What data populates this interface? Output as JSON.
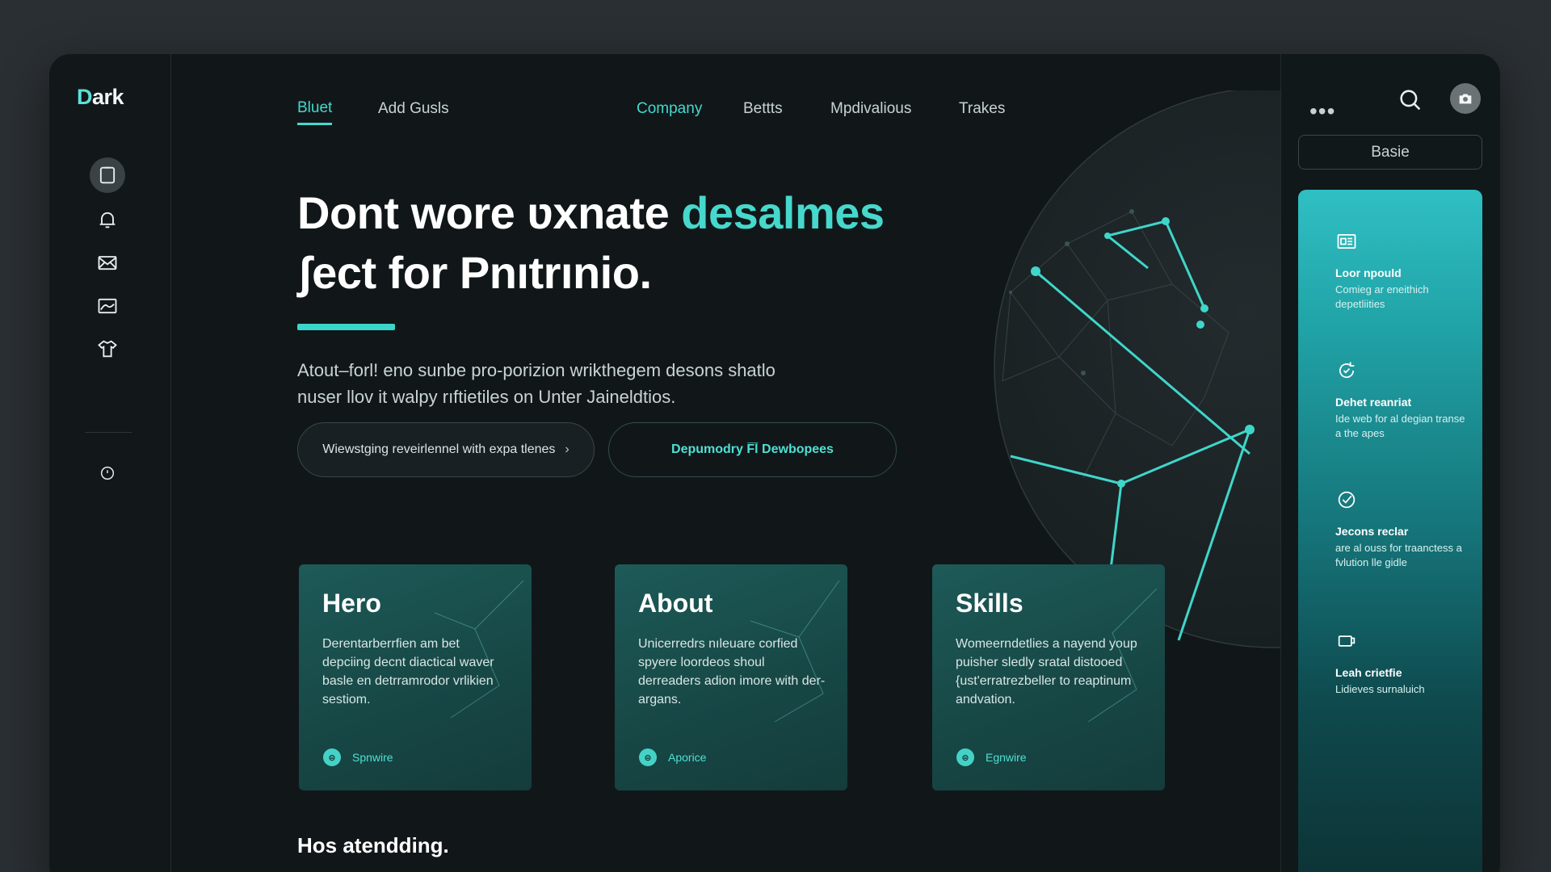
{
  "app": {
    "logo": "Dark",
    "logo_first": "D",
    "logo_rest": "ark"
  },
  "nav": {
    "items": [
      {
        "label": "Bluet",
        "state": "active"
      },
      {
        "label": "Add Gusls",
        "state": "normal"
      },
      {
        "label": "Company",
        "state": "accent"
      },
      {
        "label": "Bettts",
        "state": "normal"
      },
      {
        "label": "Mpdivalious",
        "state": "normal"
      },
      {
        "label": "Trakes",
        "state": "normal"
      }
    ]
  },
  "sidebar": {
    "icons": [
      "clipboard-icon",
      "bell-icon",
      "mail-icon",
      "image-icon",
      "shirt-icon",
      "power-icon"
    ]
  },
  "hero": {
    "title_part1": "Dont wore ʋxnate ",
    "title_highlight": "desalmes",
    "title_line2": "ʃect for Pnıtrınio.",
    "description_line1": "Atout–forl! eno sunbe pro-porizion wrikthegem desons shatlo",
    "description_line2": "nuser llov it walpy rıftietiles on Unter Jaineldtios.",
    "button_primary": "Wiewstging reveirlennel with expa tlenes",
    "button_secondary": "Depumodry F̅̅l Dewbopees"
  },
  "cards": [
    {
      "title": "Hero",
      "body": "Derentarberrfien am bet depciing decnt diactical waver basle en detrramrodor vrlikien sestiom.",
      "link": "Spnwire"
    },
    {
      "title": "About",
      "body": "Unicerredrs nıleuare corfied spyere loordeos shoul derreaders adion imore with der-argans.",
      "link": "Aporice"
    },
    {
      "title": "Skills",
      "body": "Womeerndetlies a nayend youp puisher sledly sratal distooed {ust'erratrezbeller to reaptinum andvation.",
      "link": "Egnwire"
    }
  ],
  "section": {
    "title": "Hos atendding."
  },
  "right_panel": {
    "more_label": "•••",
    "plan_label": "Basie",
    "features": [
      {
        "icon": "document-icon",
        "title": "Loor npould",
        "text": "Comieg ar eneithich depetliities"
      },
      {
        "icon": "refresh-icon",
        "title": "Dehet reanriat",
        "text": "Ide web for al degian transe a the apes"
      },
      {
        "icon": "check-badge-icon",
        "title": "Jecons reclar",
        "text": "are al ouss for traanctess a fvlution lle gidle"
      },
      {
        "icon": "cup-icon",
        "title": "Leah crietfie",
        "text": "Lidieves surnaluich"
      }
    ]
  },
  "colors": {
    "accent": "#46d8cc",
    "background": "#111719",
    "card": "#1a504e",
    "panel": "#2fbfc3"
  }
}
